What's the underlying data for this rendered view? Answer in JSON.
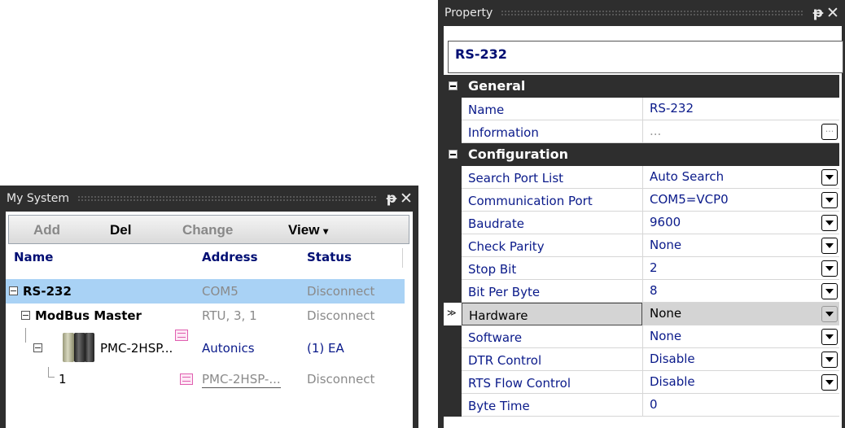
{
  "my_system": {
    "title": "My System",
    "toolbar": {
      "add": "Add",
      "del": "Del",
      "change": "Change",
      "view": "View",
      "view_arrow": "▾"
    },
    "columns": {
      "name": "Name",
      "address": "Address",
      "status": "Status"
    },
    "tree": [
      {
        "name": "RS-232",
        "address": "COM5",
        "status": "Disconnect"
      },
      {
        "name": "ModBus Master",
        "address": "RTU, 3, 1",
        "status": "Disconnect"
      },
      {
        "name": "PMC-2HSP...",
        "address": "Autonics",
        "status": "(1) EA"
      },
      {
        "name": "1",
        "address": "PMC-2HSP-...",
        "status": "Disconnect"
      }
    ],
    "pin_glyph": "ᵽ",
    "close_glyph": "✕"
  },
  "property": {
    "title": "Property",
    "object_name": "RS-232",
    "categories": {
      "general": "General",
      "configuration": "Configuration"
    },
    "rows": [
      {
        "name": "Name",
        "value": "RS-232"
      },
      {
        "name": "Information",
        "value": "...",
        "dots": "..."
      },
      {
        "name": "Search Port List",
        "value": "Auto Search"
      },
      {
        "name": "Communication Port",
        "value": "COM5=VCP0"
      },
      {
        "name": "Baudrate",
        "value": "9600"
      },
      {
        "name": "Check Parity",
        "value": "None"
      },
      {
        "name": "Stop Bit",
        "value": "2"
      },
      {
        "name": "Bit Per Byte",
        "value": "8"
      },
      {
        "name": "Hardware",
        "value": "None",
        "marker": "≫"
      },
      {
        "name": "Software",
        "value": "None"
      },
      {
        "name": "DTR Control",
        "value": "Disable"
      },
      {
        "name": "RTS Flow Control",
        "value": "Disable"
      },
      {
        "name": "Byte Time",
        "value": "0"
      }
    ],
    "pin_glyph": "ᵽ",
    "close_glyph": "✕"
  },
  "colors": {
    "panel_bg": "#2e2e2e",
    "selection": "#a9d2f5",
    "header_text": "#000e73"
  }
}
